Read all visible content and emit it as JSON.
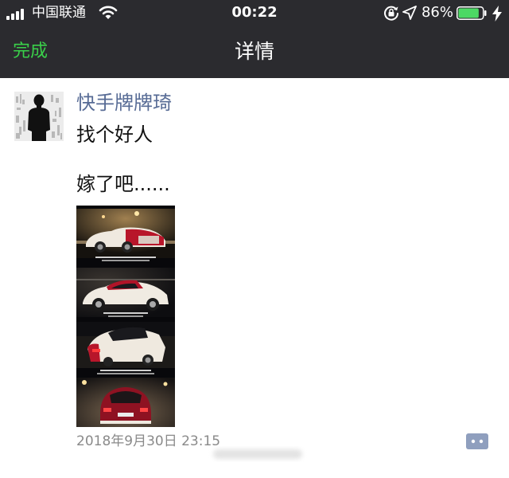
{
  "status_bar": {
    "carrier": "中国联通",
    "time": "00:22",
    "battery_percent": "86%",
    "battery_level": 0.86,
    "icons": [
      "signal-icon",
      "wifi-icon",
      "rotation-lock-icon",
      "location-arrow-icon",
      "battery-icon",
      "charging-bolt-icon"
    ]
  },
  "nav": {
    "done_label": "完成",
    "title": "详情"
  },
  "post": {
    "author": "快手牌牌琦",
    "text_line_1": "找个好人",
    "text_line_2": "嫁了吧......",
    "timestamp": "2018年9月30日 23:15",
    "photo_count": 4
  },
  "colors": {
    "header_bg": "#2b2b2f",
    "accent_green": "#3ad04a",
    "author_blue": "#576b95",
    "comment_button": "#8f9fbe"
  }
}
